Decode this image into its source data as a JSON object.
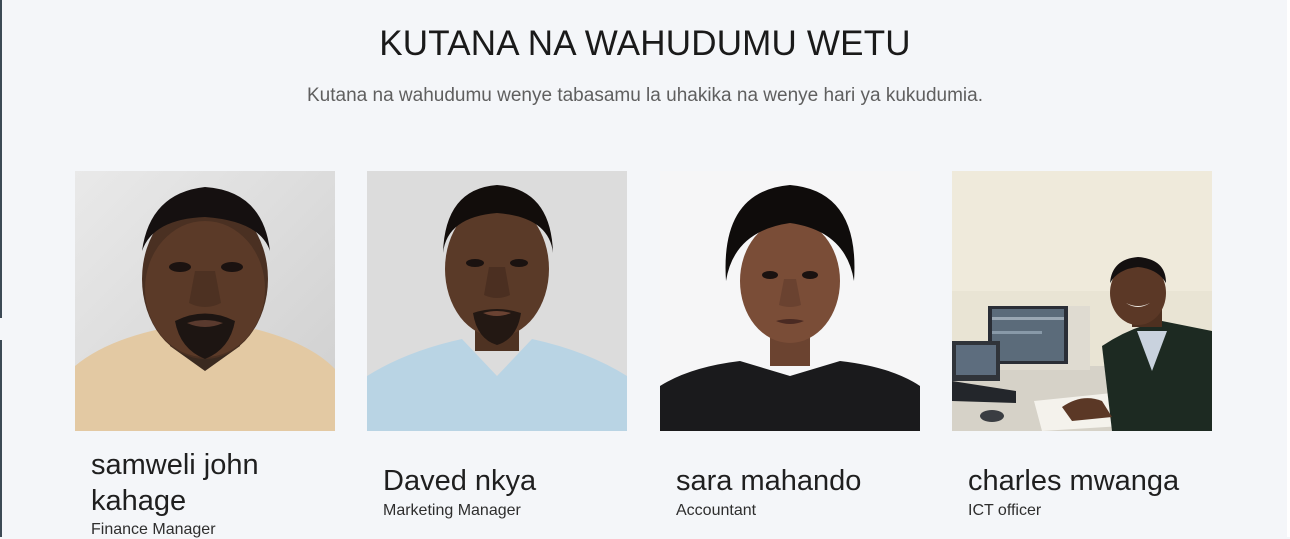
{
  "header": {
    "title": "KUTANA NA WAHUDUMU WETU",
    "subtitle": "Kutana na wahudumu wenye tabasamu la uhakika na wenye hari ya kukudumia."
  },
  "team": [
    {
      "name": "samweli john kahage",
      "role": "Finance Manager",
      "photo": "man-beige-shirt-portrait"
    },
    {
      "name": "Daved nkya",
      "role": "Marketing Manager",
      "photo": "man-blue-shirt-portrait"
    },
    {
      "name": "sara mahando",
      "role": "Accountant",
      "photo": "woman-black-top-portrait"
    },
    {
      "name": "charles mwanga",
      "role": "ICT officer",
      "photo": "man-at-desk-with-computers"
    }
  ],
  "colors": {
    "background": "#f4f6f9",
    "title": "#1a1a1a",
    "subtitle": "#5f5f5f"
  }
}
